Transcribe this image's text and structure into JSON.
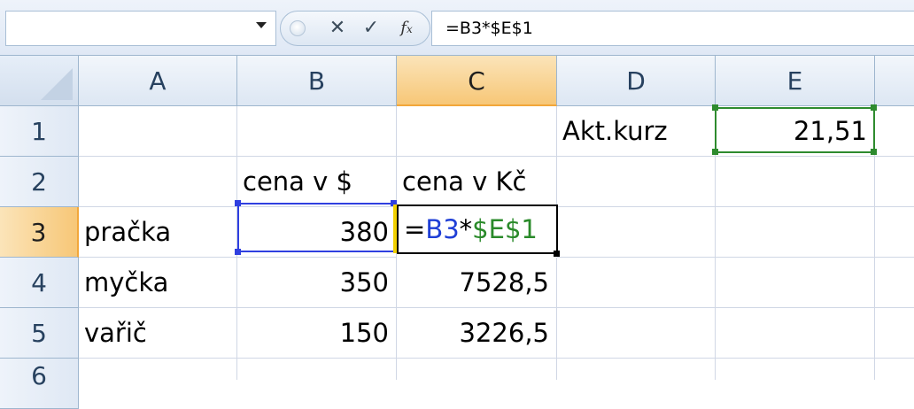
{
  "formula_bar": {
    "name_box": "",
    "cancel_icon": "✕",
    "enter_icon": "✓",
    "insert_function_label": "fx",
    "formula": "=B3*$E$1"
  },
  "columns": [
    "A",
    "B",
    "C",
    "D",
    "E"
  ],
  "rows": [
    "1",
    "2",
    "3",
    "4",
    "5",
    "6"
  ],
  "active_cell": "C3",
  "cells": {
    "D1": "Akt.kurz",
    "E1": "21,51",
    "B2": "cena v $",
    "C2": "cena v Kč",
    "A3": "pračka",
    "B3": "380",
    "A4": "myčka",
    "B4": "350",
    "C4": "7528,5",
    "A5": "vařič",
    "B5": "150",
    "C5": "3226,5"
  },
  "edit_formula": {
    "eq": "=",
    "ref1": "B3",
    "op": "*",
    "ref2": "$E$1"
  },
  "colors": {
    "ref1_color": "#1f3fd6",
    "ref2_color": "#2a8a2a",
    "active_header": "#f7c777"
  }
}
